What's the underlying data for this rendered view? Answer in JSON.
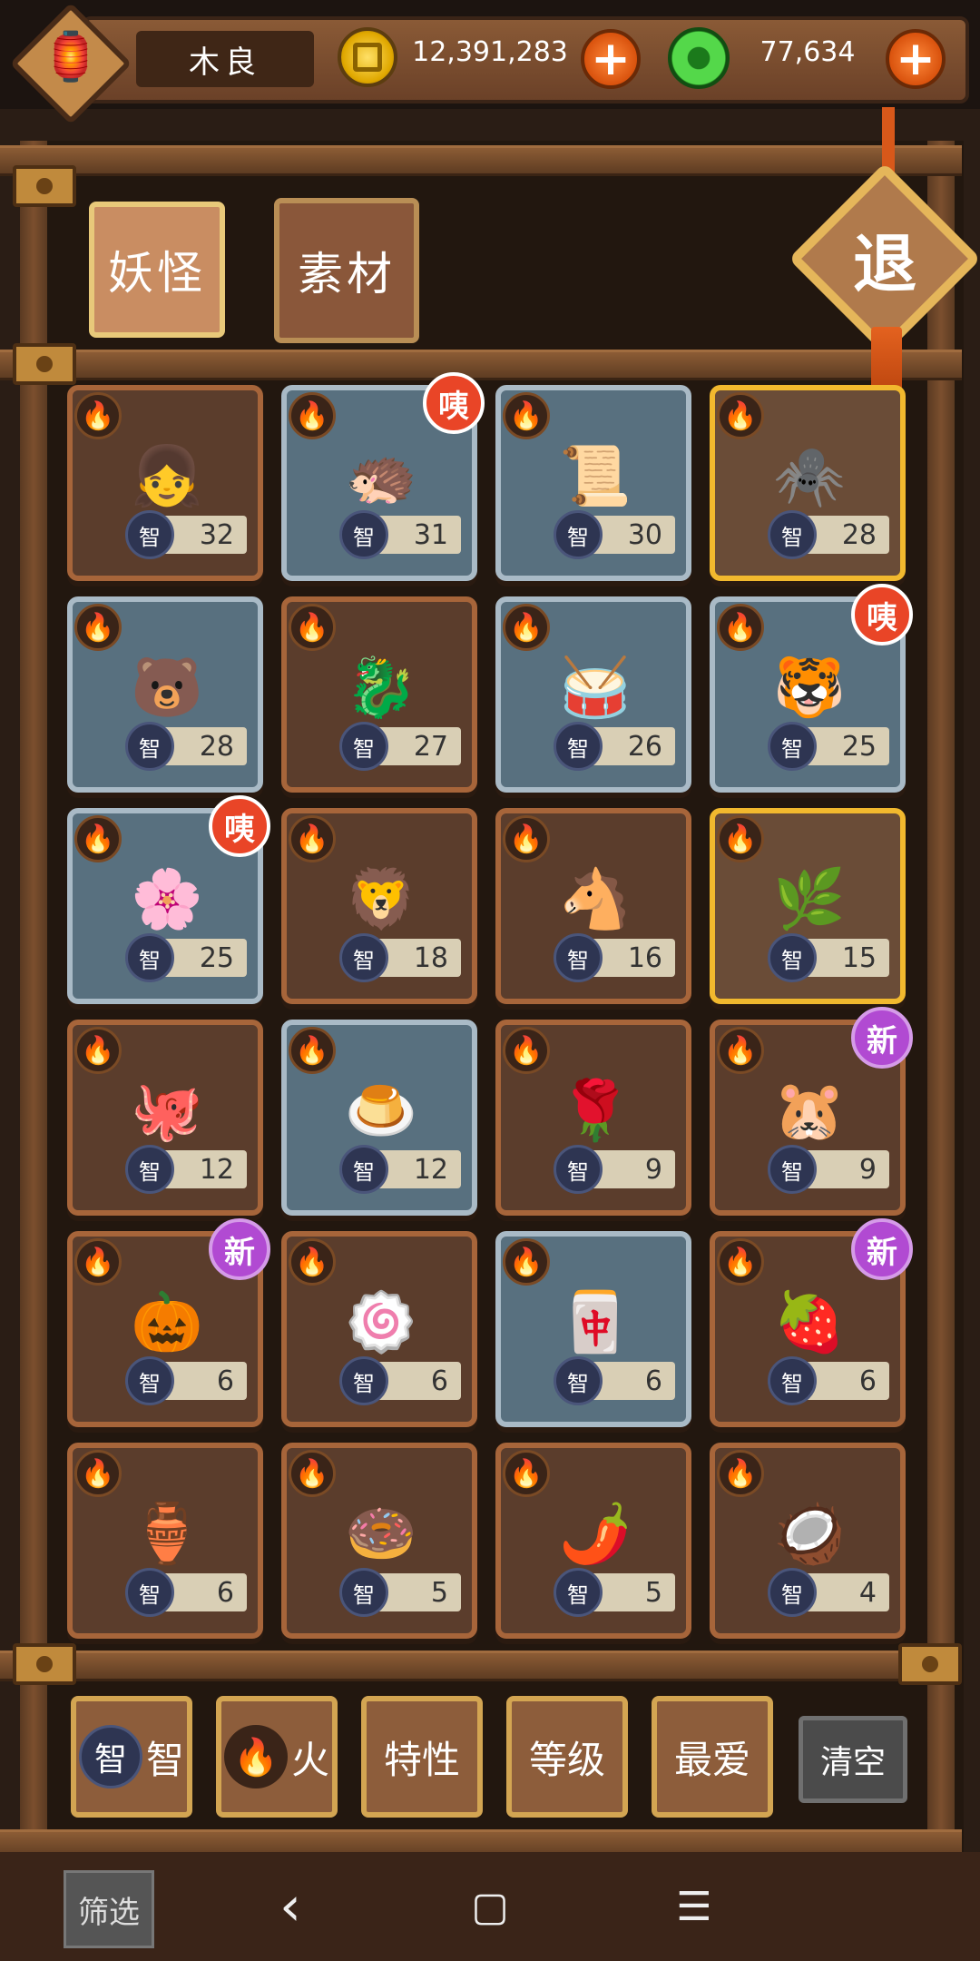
{
  "player": {
    "name": "木良"
  },
  "currency": {
    "coins": "12,391,283",
    "jade": "77,634",
    "plus": "+"
  },
  "tabs": [
    {
      "label": "妖怪"
    },
    {
      "label": "素材"
    }
  ],
  "exit_label": "退",
  "stat_prefix": "智",
  "fire_glyph": "🔥",
  "grid": [
    {
      "rarity": "brown",
      "level": "32",
      "art": "👧"
    },
    {
      "rarity": "blue",
      "level": "31",
      "art": "🦔",
      "badge": "咦"
    },
    {
      "rarity": "blue",
      "level": "30",
      "art": "📜"
    },
    {
      "rarity": "gold",
      "level": "28",
      "art": "🕷️"
    },
    {
      "rarity": "blue",
      "level": "28",
      "art": "🐻"
    },
    {
      "rarity": "brown",
      "level": "27",
      "art": "🐉"
    },
    {
      "rarity": "blue",
      "level": "26",
      "art": "🥁"
    },
    {
      "rarity": "blue",
      "level": "25",
      "art": "🐯",
      "badge": "咦"
    },
    {
      "rarity": "blue",
      "level": "25",
      "art": "🌸",
      "badge": "咦"
    },
    {
      "rarity": "brown",
      "level": "18",
      "art": "🦁"
    },
    {
      "rarity": "brown",
      "level": "16",
      "art": "🐴"
    },
    {
      "rarity": "gold",
      "level": "15",
      "art": "🌿"
    },
    {
      "rarity": "brown",
      "level": "12",
      "art": "🐙"
    },
    {
      "rarity": "blue",
      "level": "12",
      "art": "🍮"
    },
    {
      "rarity": "brown",
      "level": "9",
      "art": "🌹"
    },
    {
      "rarity": "brown",
      "level": "9",
      "art": "🐹",
      "badge": "新"
    },
    {
      "rarity": "brown",
      "level": "6",
      "art": "🎃",
      "badge": "新"
    },
    {
      "rarity": "brown",
      "level": "6",
      "art": "🍥"
    },
    {
      "rarity": "blue",
      "level": "6",
      "art": "🀄"
    },
    {
      "rarity": "brown",
      "level": "6",
      "art": "🍓",
      "badge": "新"
    },
    {
      "rarity": "brown",
      "level": "6",
      "art": "🏺"
    },
    {
      "rarity": "brown",
      "level": "5",
      "art": "🍩"
    },
    {
      "rarity": "brown",
      "level": "5",
      "art": "🌶️"
    },
    {
      "rarity": "brown",
      "level": "4",
      "art": "🥥"
    }
  ],
  "filters": [
    {
      "label": "智",
      "icon": "智"
    },
    {
      "label": "火",
      "icon": "🔥"
    },
    {
      "label": "特性"
    },
    {
      "label": "等级"
    },
    {
      "label": "最爱"
    }
  ],
  "clear_label": "清空",
  "nav": {
    "filter_label": "筛选",
    "back": "‹",
    "home": "▢",
    "menu": "☰"
  }
}
